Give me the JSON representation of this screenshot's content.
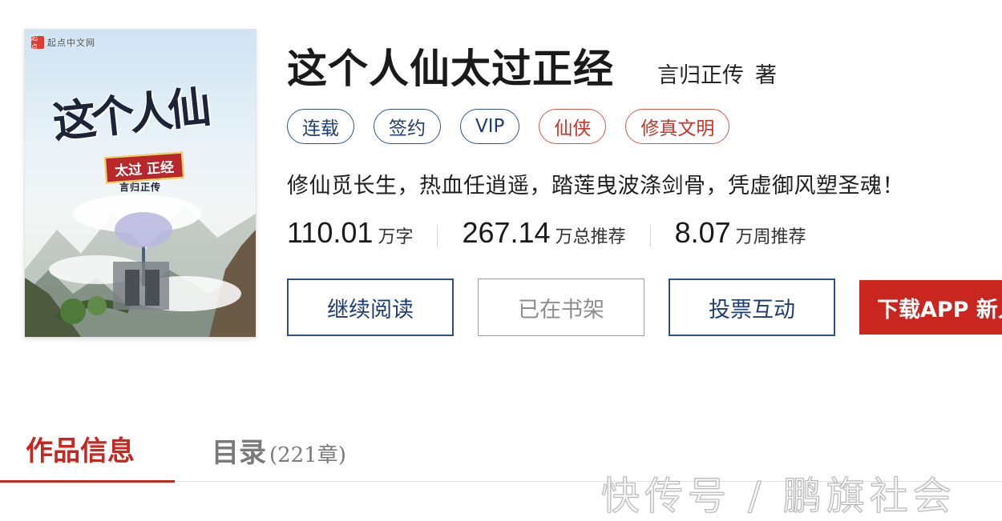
{
  "cover": {
    "publisher": "起点中文网",
    "publisher_badge": "起点",
    "title_art": "这个人仙",
    "subtitle_art": "太过 正经",
    "author_art": "言归正传"
  },
  "book": {
    "title": "这个人仙太过正经",
    "author": "言归正传",
    "author_suffix": "著",
    "tags": [
      {
        "label": "连载",
        "color": "blue"
      },
      {
        "label": "签约",
        "color": "blue"
      },
      {
        "label": "VIP",
        "color": "blue"
      },
      {
        "label": "仙侠",
        "color": "red"
      },
      {
        "label": "修真文明",
        "color": "red"
      }
    ],
    "intro": "修仙觅长生，热血任逍遥，踏莲曳波涤剑骨，凭虚御风塑圣魂！",
    "stats": [
      {
        "value": "110.01",
        "unit": "万字"
      },
      {
        "value": "267.14",
        "unit": "万总推荐"
      },
      {
        "value": "8.07",
        "unit": "万周推荐"
      }
    ]
  },
  "actions": {
    "continue_reading": "继续阅读",
    "in_bookshelf": "已在书架",
    "vote": "投票互动",
    "download": "下载APP 新人"
  },
  "tabs": {
    "info": "作品信息",
    "catalog": "目录",
    "catalog_count": "(221章)"
  },
  "watermark": "快传号 / 鹏旗社会",
  "colors": {
    "accent_red": "#c8261f",
    "tag_blue": "#1f3d75",
    "tag_red": "#c9342a"
  }
}
